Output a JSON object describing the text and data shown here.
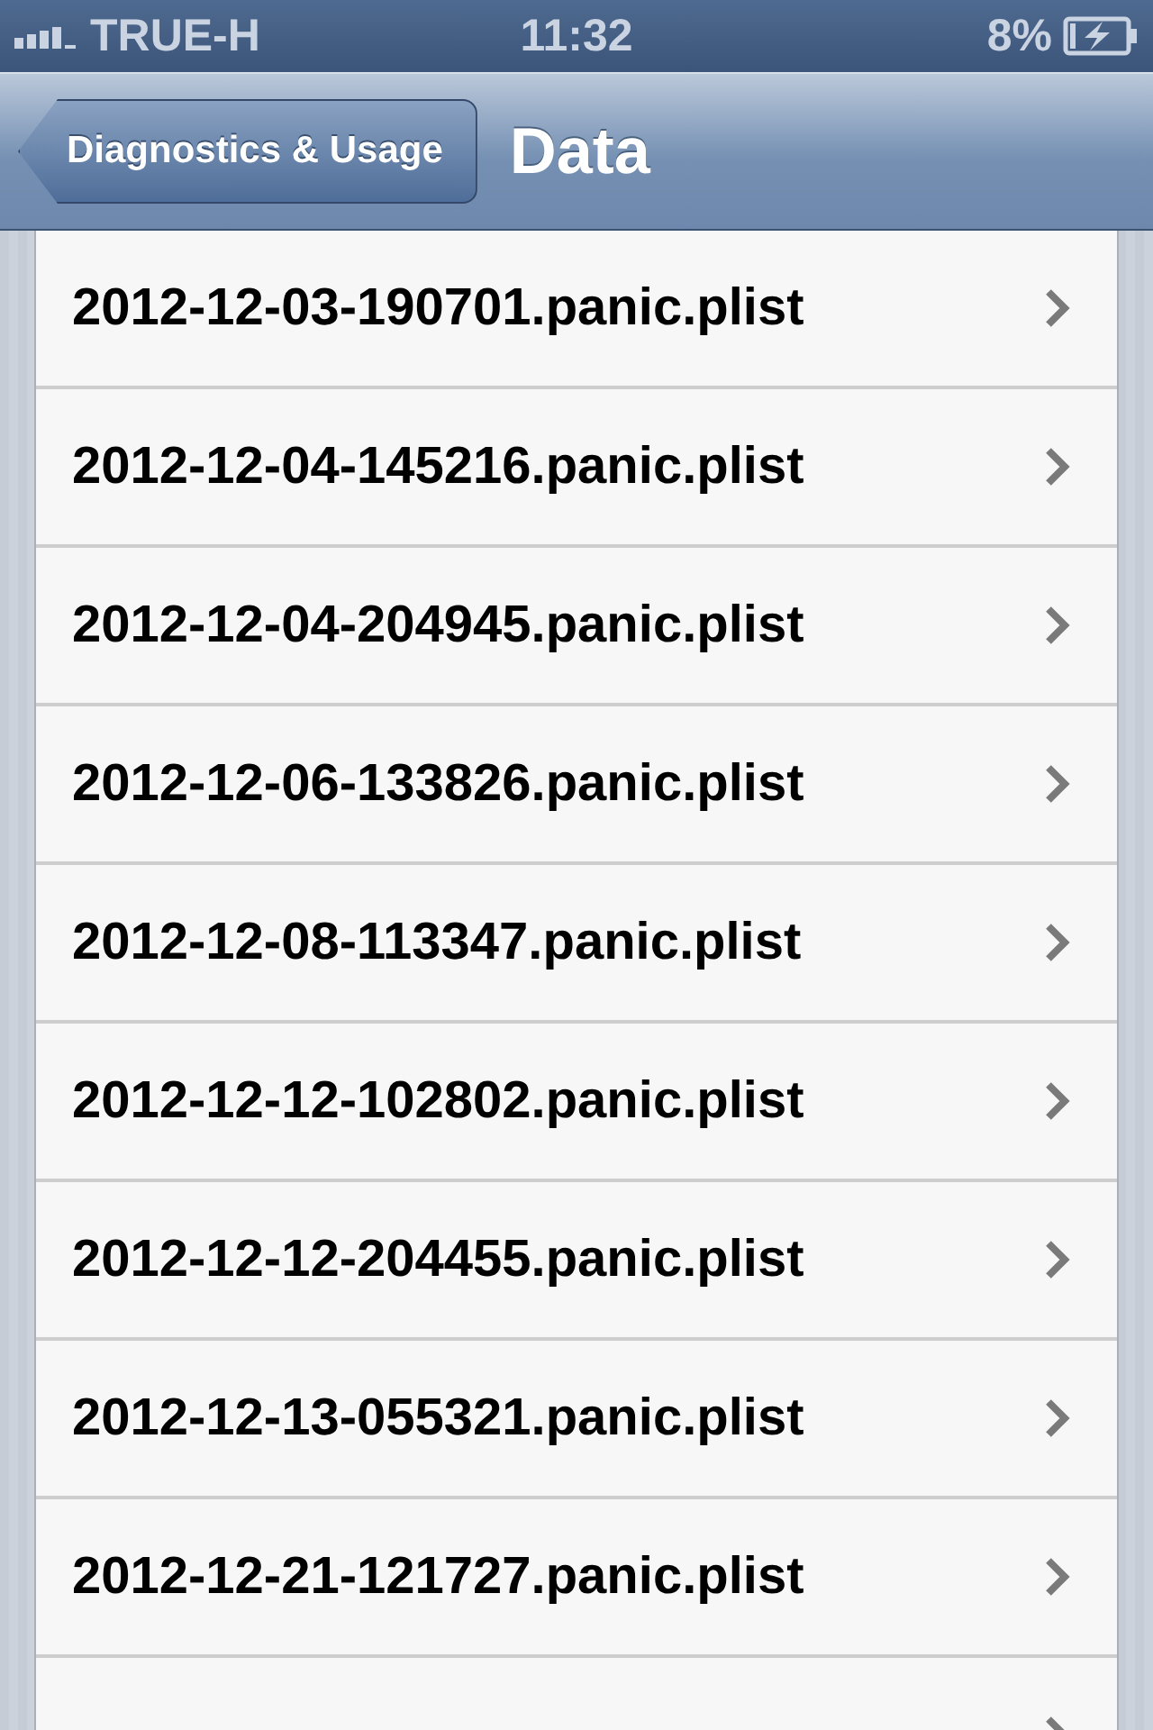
{
  "status_bar": {
    "carrier": "TRUE-H",
    "time": "11:32",
    "battery": "8%"
  },
  "nav_bar": {
    "back_button": "Diagnostics & Usage",
    "title": "Data"
  },
  "rows": [
    {
      "label": "2012-12-03-190701.panic.plist"
    },
    {
      "label": "2012-12-04-145216.panic.plist"
    },
    {
      "label": "2012-12-04-204945.panic.plist"
    },
    {
      "label": "2012-12-06-133826.panic.plist"
    },
    {
      "label": "2012-12-08-113347.panic.plist"
    },
    {
      "label": "2012-12-12-102802.panic.plist"
    },
    {
      "label": "2012-12-12-204455.panic.plist"
    },
    {
      "label": "2012-12-13-055321.panic.plist"
    },
    {
      "label": "2012-12-21-121727.panic.plist"
    },
    {}
  ]
}
